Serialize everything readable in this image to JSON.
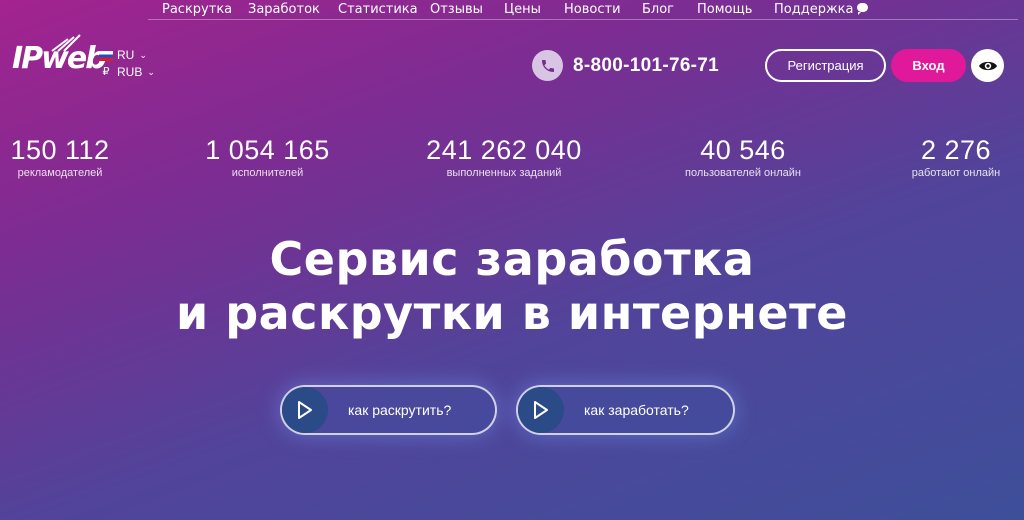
{
  "nav": {
    "items": [
      {
        "label": "Раскрутка"
      },
      {
        "label": "Заработок"
      },
      {
        "label": "Статистика"
      },
      {
        "label": "Отзывы"
      },
      {
        "label": "Цены"
      },
      {
        "label": "Новости"
      },
      {
        "label": "Блог"
      },
      {
        "label": "Помощь"
      },
      {
        "label": "Поддержка"
      }
    ]
  },
  "logo": {
    "text": "IPweb"
  },
  "language": {
    "current": "RU",
    "currency": "RUB",
    "currency_symbol": "₽"
  },
  "phone": {
    "number": "8-800-101-76-71"
  },
  "auth": {
    "register_label": "Регистрация",
    "login_label": "Вход"
  },
  "stats": [
    {
      "value": "150 112",
      "label": "рекламодателей"
    },
    {
      "value": "1 054 165",
      "label": "исполнителей"
    },
    {
      "value": "241 262 040",
      "label": "выполненных заданий"
    },
    {
      "value": "40 546",
      "label": "пользователей онлайн"
    },
    {
      "value": "2 276",
      "label": "работают онлайн"
    }
  ],
  "hero": {
    "line1": "Сервис заработка",
    "line2": "и раскрутки в интернете"
  },
  "cta": [
    {
      "label": "как раскрутить?"
    },
    {
      "label": "как заработать?"
    }
  ],
  "colors": {
    "accent": "#e0189a",
    "bg_top": "#a3238f",
    "bg_bottom": "#3e4f9a"
  },
  "icons": [
    "chat-icon",
    "phone-icon",
    "eye-icon",
    "play-icon",
    "flag-ru-icon",
    "chevron-down-icon"
  ]
}
